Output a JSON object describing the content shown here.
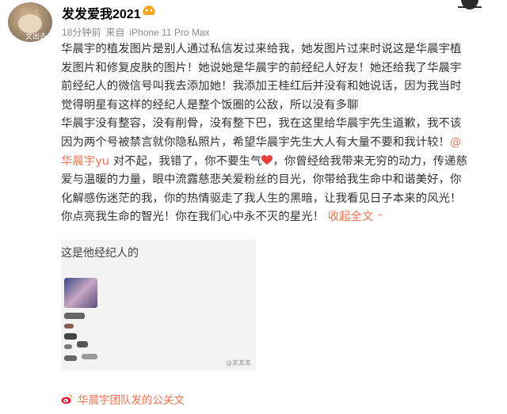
{
  "header": {
    "username": "发发爱我2021",
    "avatar_watermark": "文出去",
    "vip_badge": "vip",
    "meta": {
      "time": "18分钟前",
      "source_prefix": "来自",
      "device": "iPhone 11 Pro Max"
    }
  },
  "post": {
    "lines": [
      "华晨宇的植发图片是别人通过私信发过来给我，她发图片过来时说这是华晨宇植",
      "发图片和修复皮肤的图片！她说她是华晨宇的前经纪人好友！她还给我了华晨宇",
      "前经纪人的微信号叫我去添加她！我添加王桂红后并没有和她说话，因为我当时",
      "觉得明星有这样的经纪人是整个饭圈的公敌，所以没有多聊",
      "华晨宇没有整容，没有削骨，没有整下巴，我在这里给华晨宇先生道歉，我不该",
      "因为两个号被禁言就你隐私照片，希望华晨宇先生大人有大量不要和我计较！"
    ],
    "mention_at": "@",
    "mention_name": "华晨宇yu",
    "apology": "对不起，我错了，你不要生气",
    "after_heart": "，你曾经给我带来无穷的动力，传递慈",
    "lines2": [
      "爱与温暖的力量，眼中流露慈悲关爱粉丝的目光，你带给我生命中和谐美好，你",
      "化解感伤迷茫的我，你的热情驱走了我人生的黑暗，让我看见日子本来的风光！"
    ],
    "last_line": "你点亮我生命的智光！你在我们心中永不灭的星光！",
    "collapse_label": "收起全文",
    "colors": {
      "accent": "#eb7350",
      "heart": "#e8413c"
    }
  },
  "image": {
    "caption": "这是他经纪人的",
    "watermark": "@某某某"
  },
  "footer": {
    "label": "华晨宇团队发的公关文"
  }
}
